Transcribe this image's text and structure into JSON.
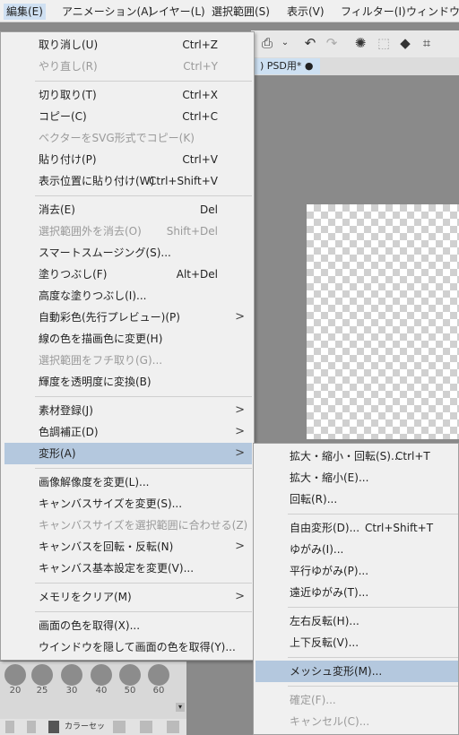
{
  "menubar": {
    "items": [
      "編集(E)",
      "アニメーション(A)",
      "レイヤー(L)",
      "選択範囲(S)",
      "表示(V)",
      "フィルター(I)",
      "ウィンドウ("
    ]
  },
  "toolbar": {
    "icons": [
      "print-icon",
      "chevron-down-icon",
      "undo-icon",
      "redo-icon",
      "loading-icon",
      "transform-icon",
      "fill-icon",
      "crop-icon"
    ]
  },
  "document_tab": {
    "label": ") PSD用* ●"
  },
  "brush_sizes": [
    "20",
    "25",
    "30",
    "40",
    "50",
    "60"
  ],
  "panel_tabs": {
    "color_set": "カラーセッ"
  },
  "edit_menu": {
    "items": [
      {
        "label": "取り消し(U)",
        "shortcut": "Ctrl+Z",
        "disabled": false,
        "submenu": false
      },
      {
        "label": "やり直し(R)",
        "shortcut": "Ctrl+Y",
        "disabled": true,
        "submenu": false
      },
      {
        "label": "切り取り(T)",
        "shortcut": "Ctrl+X",
        "disabled": false,
        "submenu": false
      },
      {
        "label": "コピー(C)",
        "shortcut": "Ctrl+C",
        "disabled": false,
        "submenu": false
      },
      {
        "label": "ベクターをSVG形式でコピー(K)",
        "shortcut": "",
        "disabled": true,
        "submenu": false
      },
      {
        "label": "貼り付け(P)",
        "shortcut": "Ctrl+V",
        "disabled": false,
        "submenu": false
      },
      {
        "label": "表示位置に貼り付け(W)",
        "shortcut": "Ctrl+Shift+V",
        "disabled": false,
        "submenu": false
      },
      {
        "label": "消去(E)",
        "shortcut": "Del",
        "disabled": false,
        "submenu": false
      },
      {
        "label": "選択範囲外を消去(O)",
        "shortcut": "Shift+Del",
        "disabled": true,
        "submenu": false
      },
      {
        "label": "スマートスムージング(S)...",
        "shortcut": "",
        "disabled": false,
        "submenu": false
      },
      {
        "label": "塗りつぶし(F)",
        "shortcut": "Alt+Del",
        "disabled": false,
        "submenu": false
      },
      {
        "label": "高度な塗りつぶし(I)...",
        "shortcut": "",
        "disabled": false,
        "submenu": false
      },
      {
        "label": "自動彩色(先行プレビュー)(P)",
        "shortcut": "",
        "disabled": false,
        "submenu": true
      },
      {
        "label": "線の色を描画色に変更(H)",
        "shortcut": "",
        "disabled": false,
        "submenu": false
      },
      {
        "label": "選択範囲をフチ取り(G)...",
        "shortcut": "",
        "disabled": true,
        "submenu": false
      },
      {
        "label": "輝度を透明度に変換(B)",
        "shortcut": "",
        "disabled": false,
        "submenu": false
      },
      {
        "label": "素材登録(J)",
        "shortcut": "",
        "disabled": false,
        "submenu": true
      },
      {
        "label": "色調補正(D)",
        "shortcut": "",
        "disabled": false,
        "submenu": true
      },
      {
        "label": "変形(A)",
        "shortcut": "",
        "disabled": false,
        "submenu": true,
        "highlighted": true
      },
      {
        "label": "画像解像度を変更(L)...",
        "shortcut": "",
        "disabled": false,
        "submenu": false
      },
      {
        "label": "キャンバスサイズを変更(S)...",
        "shortcut": "",
        "disabled": false,
        "submenu": false
      },
      {
        "label": "キャンバスサイズを選択範囲に合わせる(Z)",
        "shortcut": "",
        "disabled": true,
        "submenu": false
      },
      {
        "label": "キャンバスを回転・反転(N)",
        "shortcut": "",
        "disabled": false,
        "submenu": true
      },
      {
        "label": "キャンバス基本設定を変更(V)...",
        "shortcut": "",
        "disabled": false,
        "submenu": false
      },
      {
        "label": "メモリをクリア(M)",
        "shortcut": "",
        "disabled": false,
        "submenu": true
      },
      {
        "label": "画面の色を取得(X)...",
        "shortcut": "",
        "disabled": false,
        "submenu": false
      },
      {
        "label": "ウインドウを隠して画面の色を取得(Y)...",
        "shortcut": "",
        "disabled": false,
        "submenu": false
      }
    ]
  },
  "transform_submenu": {
    "items": [
      {
        "label": "拡大・縮小・回転(S)...",
        "shortcut": "Ctrl+T",
        "disabled": false
      },
      {
        "label": "拡大・縮小(E)...",
        "shortcut": "",
        "disabled": false
      },
      {
        "label": "回転(R)...",
        "shortcut": "",
        "disabled": false
      },
      {
        "label": "自由変形(D)...",
        "shortcut": "Ctrl+Shift+T",
        "disabled": false
      },
      {
        "label": "ゆがみ(I)...",
        "shortcut": "",
        "disabled": false
      },
      {
        "label": "平行ゆがみ(P)...",
        "shortcut": "",
        "disabled": false
      },
      {
        "label": "遠近ゆがみ(T)...",
        "shortcut": "",
        "disabled": false
      },
      {
        "label": "左右反転(H)...",
        "shortcut": "",
        "disabled": false
      },
      {
        "label": "上下反転(V)...",
        "shortcut": "",
        "disabled": false
      },
      {
        "label": "メッシュ変形(M)...",
        "shortcut": "",
        "disabled": false,
        "highlighted": true
      },
      {
        "label": "確定(F)...",
        "shortcut": "",
        "disabled": true
      },
      {
        "label": "キャンセル(C)...",
        "shortcut": "",
        "disabled": true
      }
    ]
  }
}
